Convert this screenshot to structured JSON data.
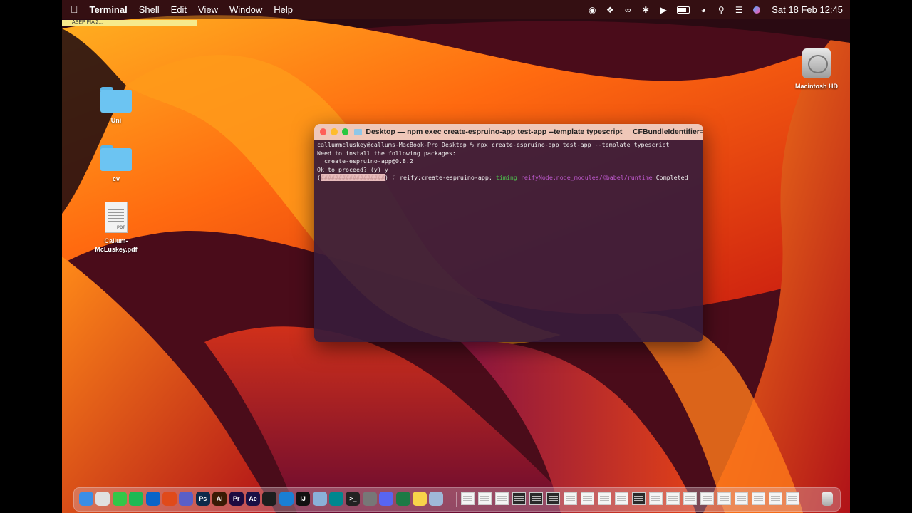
{
  "menubar": {
    "apple_icon": "apple-icon",
    "app_name": "Terminal",
    "menus": [
      "Shell",
      "Edit",
      "View",
      "Window",
      "Help"
    ],
    "status_icons": [
      "record-icon",
      "figma-icon",
      "creative-cloud-icon",
      "bluetooth-icon",
      "play-icon",
      "battery-icon",
      "wifi-icon",
      "search-icon",
      "control-center-icon",
      "siri-icon"
    ],
    "clock": "Sat 18 Feb  12:45"
  },
  "sticky": {
    "text": "ASEP PIA 2..."
  },
  "desktop_icons": [
    {
      "label": "Uni",
      "icon": "folder-icon"
    },
    {
      "label": "cv",
      "icon": "folder-icon"
    },
    {
      "label": "Callum-\nMcLuskey.pdf",
      "icon": "pdf-file-icon"
    },
    {
      "label": "Macintosh HD",
      "icon": "hard-drive-icon"
    }
  ],
  "terminal": {
    "title": "Desktop — npm exec create-espruino-app test-app --template typescript __CFBundleIdentifier=com...",
    "lines": [
      "callummcluskey@callums-MacBook-Pro Desktop % npx create-espruino-app test-app --template typescript",
      "Need to install the following packages:",
      "  create-espruino-app@0.8.2",
      "Ok to proceed? (y) y"
    ],
    "progress": {
      "open": "(",
      "bar": "##################",
      "close": ")",
      "spinner": " ⠏ ",
      "task": "reify:create-espruino-app:",
      "timing": "timing",
      "path": "reifyNode:node_modules/@babel/runtime",
      "status": "Completed"
    }
  },
  "dock": {
    "apps": [
      {
        "name": "finder-icon",
        "label": "",
        "color": "#3a8ee6"
      },
      {
        "name": "chrome-icon",
        "label": "",
        "color": "#e0e0e0"
      },
      {
        "name": "messages-icon",
        "label": "",
        "color": "#33c748"
      },
      {
        "name": "spotify-icon",
        "label": "",
        "color": "#1db954"
      },
      {
        "name": "outlook-icon",
        "label": "",
        "color": "#0a64c8"
      },
      {
        "name": "office-icon",
        "label": "",
        "color": "#e04a1a"
      },
      {
        "name": "teams-icon",
        "label": "",
        "color": "#5b5fc7"
      },
      {
        "name": "photoshop-icon",
        "label": "Ps",
        "color": "#0c2a4a"
      },
      {
        "name": "illustrator-icon",
        "label": "Ai",
        "color": "#3a1a04"
      },
      {
        "name": "premiere-icon",
        "label": "Pr",
        "color": "#1e0a40"
      },
      {
        "name": "after-effects-icon",
        "label": "Ae",
        "color": "#1a1045"
      },
      {
        "name": "figma-icon",
        "label": "",
        "color": "#1e1e1e"
      },
      {
        "name": "vscode-icon",
        "label": "",
        "color": "#1a7fd4"
      },
      {
        "name": "intellij-icon",
        "label": "IJ",
        "color": "#111"
      },
      {
        "name": "postgres-icon",
        "label": "",
        "color": "#8ab0d8"
      },
      {
        "name": "arduino-icon",
        "label": "",
        "color": "#00878f"
      },
      {
        "name": "terminal-icon",
        "label": ">_",
        "color": "#222"
      },
      {
        "name": "system-settings-icon",
        "label": "",
        "color": "#777"
      },
      {
        "name": "discord-icon",
        "label": "",
        "color": "#5865f2"
      },
      {
        "name": "excel-icon",
        "label": "",
        "color": "#1d7a45"
      },
      {
        "name": "notes-icon",
        "label": "",
        "color": "#f7d44a"
      },
      {
        "name": "preview-icon",
        "label": "",
        "color": "#9fb8d8"
      }
    ],
    "windows": 20,
    "trash_icon": "trash-icon"
  }
}
